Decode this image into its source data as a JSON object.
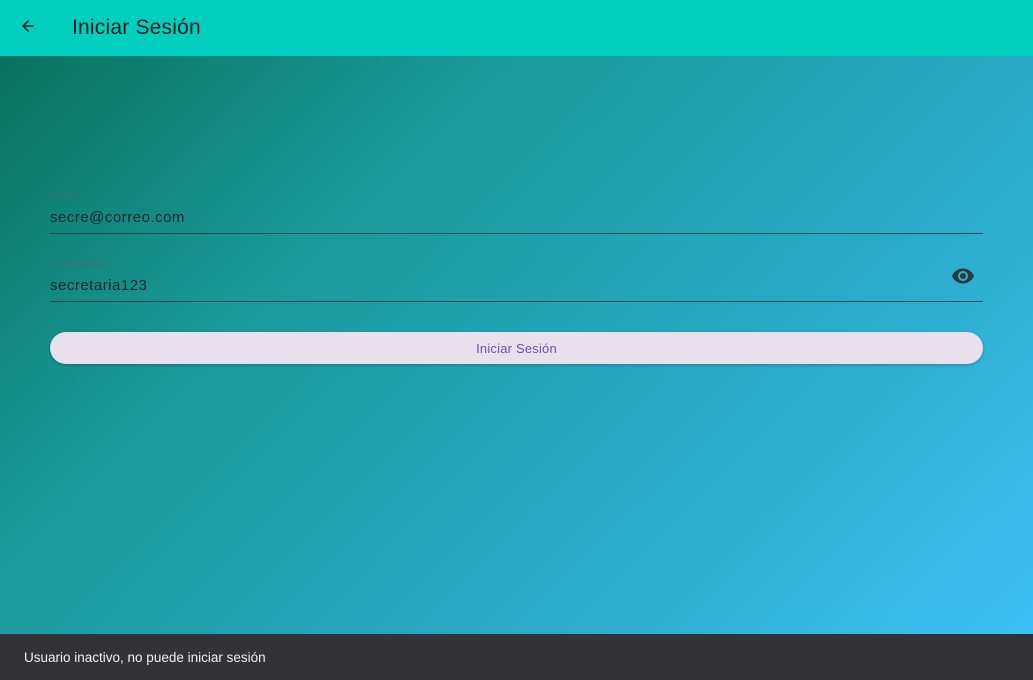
{
  "appbar": {
    "title": "Iniciar Sesión",
    "back_icon": "arrow-back-icon",
    "color": "#00cfc0"
  },
  "form": {
    "email": {
      "label": "Email",
      "value": "secre@correo.com"
    },
    "password": {
      "label": "Contraseña",
      "value": "secretaria123",
      "toggle_icon": "eye-icon"
    },
    "submit_label": "Iniciar Sesión"
  },
  "snackbar": {
    "message": "Usuario inactivo, no puede iniciar sesión"
  }
}
